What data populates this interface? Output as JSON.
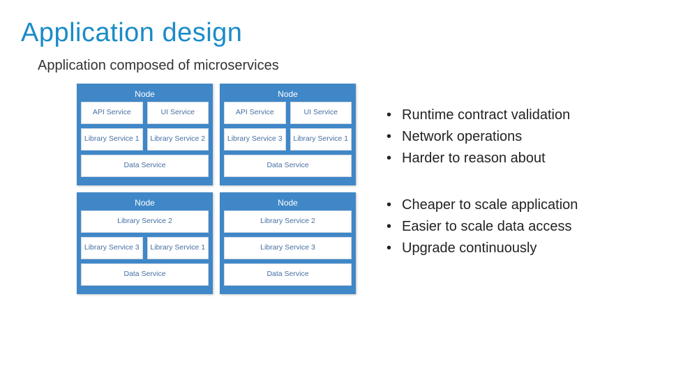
{
  "title": "Application design",
  "subtitle": "Application composed of microservices",
  "nodes": [
    {
      "title": "Node",
      "rows": [
        [
          "API Service",
          "UI Service"
        ],
        [
          "Library Service 1",
          "Library Service 2"
        ],
        [
          "Data Service"
        ]
      ]
    },
    {
      "title": "Node",
      "rows": [
        [
          "API Service",
          "UI Service"
        ],
        [
          "Library Service 3",
          "Library Service 1"
        ],
        [
          "Data Service"
        ]
      ]
    },
    {
      "title": "Node",
      "rows": [
        [
          "Library Service 2"
        ],
        [
          "Library Service 3",
          "Library Service 1"
        ],
        [
          "Data Service"
        ]
      ]
    },
    {
      "title": "Node",
      "rows": [
        [
          "Library Service 2"
        ],
        [
          "Library Service 3"
        ],
        [
          "Data Service"
        ]
      ]
    }
  ],
  "bullet_groups": [
    [
      "Runtime contract validation",
      "Network operations",
      "Harder to reason about"
    ],
    [
      "Cheaper to scale application",
      "Easier to scale data access",
      "Upgrade continuously"
    ]
  ]
}
